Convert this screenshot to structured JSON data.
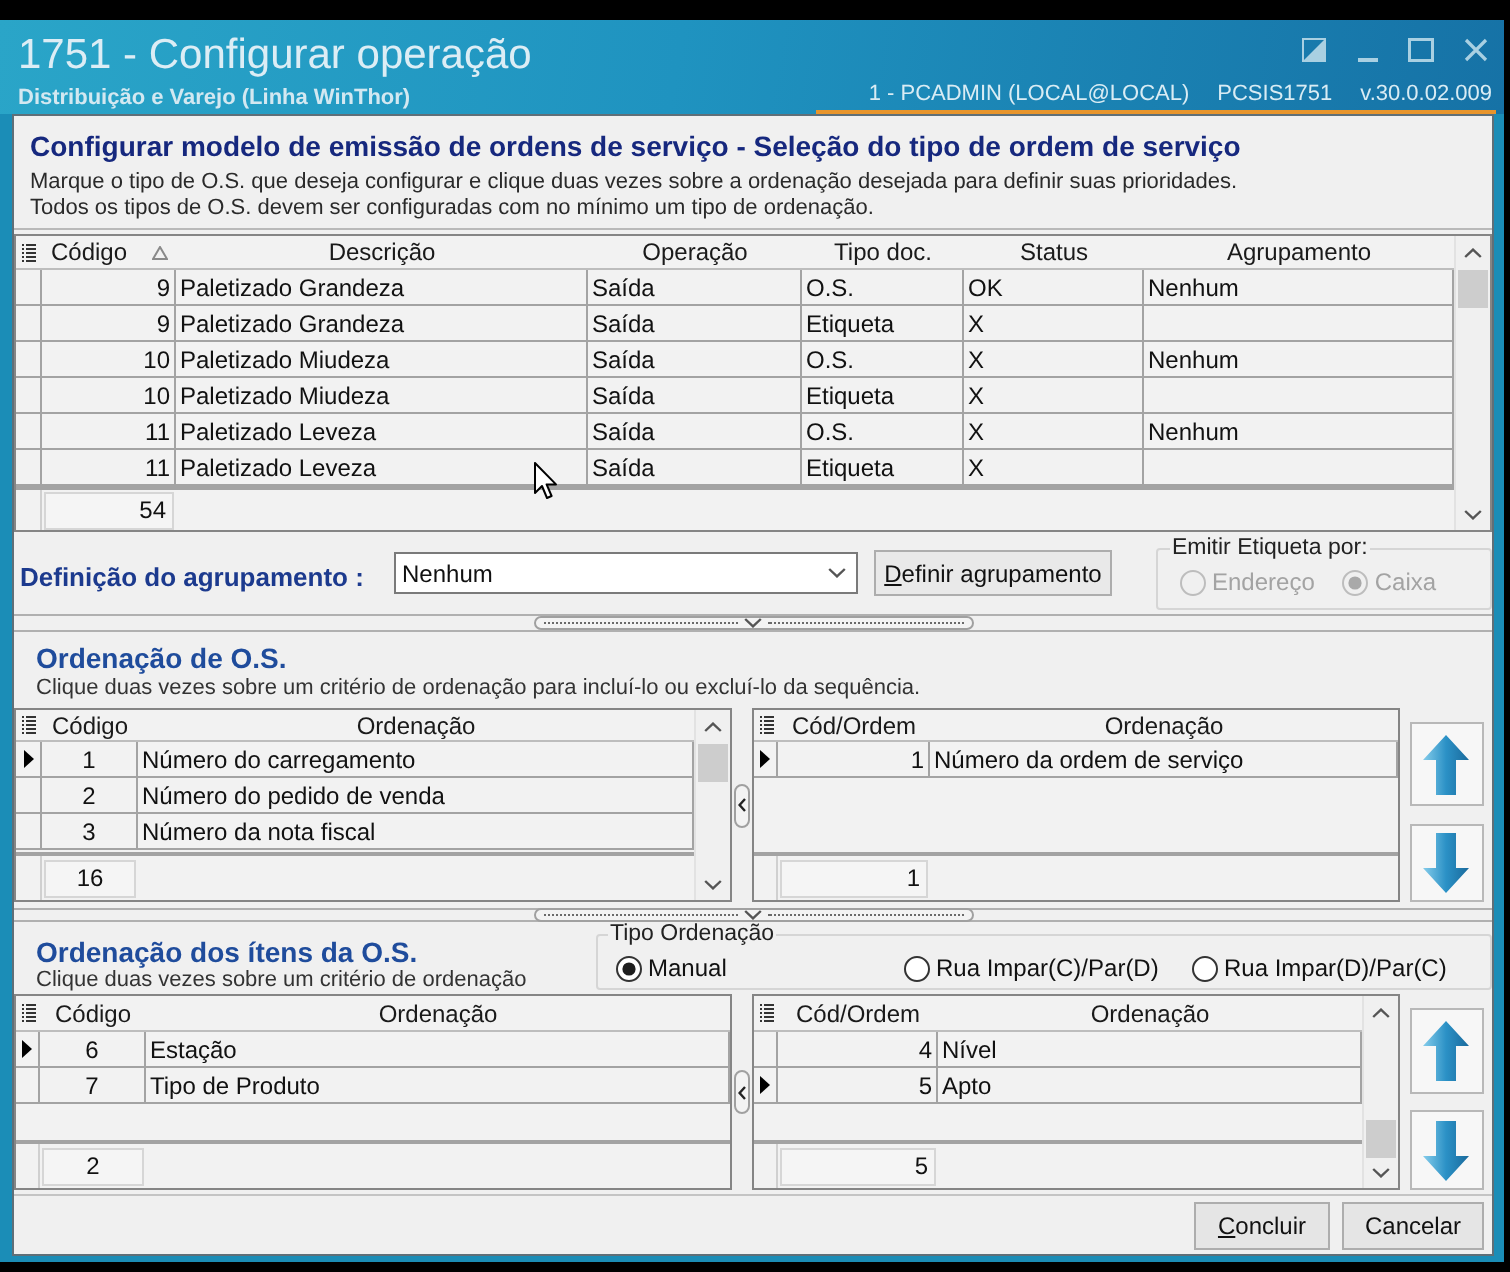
{
  "window": {
    "title": "1751 - Configurar operação",
    "subtitle": "Distribuição e Varejo (Linha WinThor)",
    "user": "1 - PCADMIN (LOCAL@LOCAL)",
    "program": "PCSIS1751",
    "version": "v.30.0.02.009"
  },
  "header": {
    "title": "Configurar modelo de emissão de ordens de serviço - Seleção do tipo de ordem de serviço",
    "lines": [
      "Marque o tipo de O.S. que deseja configurar e clique duas vezes sobre a ordenação desejada para definir suas prioridades.",
      "Todos os tipos de O.S. devem ser configuradas com no mínimo um tipo de ordenação."
    ]
  },
  "os_types_table": {
    "columns": [
      {
        "label": "Código",
        "sorted": true
      },
      {
        "label": "Descrição",
        "sorted": false
      },
      {
        "label": "Operação",
        "sorted": false
      },
      {
        "label": "Tipo doc.",
        "sorted": false
      },
      {
        "label": "Status",
        "sorted": false
      },
      {
        "label": "Agrupamento",
        "sorted": false
      }
    ],
    "rows": [
      {
        "code": "9",
        "description": "Paletizado Grandeza",
        "operation": "Saída",
        "doc_type": "O.S.",
        "status": "OK",
        "grouping": "Nenhum"
      },
      {
        "code": "9",
        "description": "Paletizado Grandeza",
        "operation": "Saída",
        "doc_type": "Etiqueta",
        "status": "X"
      },
      {
        "code": "10",
        "description": "Paletizado Miudeza",
        "operation": "Saída",
        "doc_type": "O.S.",
        "status": "X",
        "grouping": "Nenhum"
      },
      {
        "code": "10",
        "description": "Paletizado Miudeza",
        "operation": "Saída",
        "doc_type": "Etiqueta",
        "status": "X"
      },
      {
        "code": "11",
        "description": "Paletizado Leveza",
        "operation": "Saída",
        "doc_type": "O.S.",
        "status": "X",
        "grouping": "Nenhum"
      },
      {
        "code": "11",
        "description": "Paletizado Leveza",
        "operation": "Saída",
        "doc_type": "Etiqueta",
        "status": "X"
      }
    ],
    "footer": "54"
  },
  "grouping": {
    "label": "Definição do agrupamento :",
    "value": "Nenhum",
    "button": "Definir agrupamento"
  },
  "label_emission": {
    "title": "Emitir Etiqueta por:",
    "options": [
      {
        "label": "Endereço",
        "selected": false,
        "disabled": true
      },
      {
        "label": "Caixa",
        "selected": true,
        "disabled": true
      }
    ]
  },
  "os_ordering": {
    "title": "Ordenação de O.S.",
    "hint": "Clique duas vezes sobre um critério de ordenação para incluí-lo ou excluí-lo da sequência.",
    "available": {
      "columns": [
        "Código",
        "Ordenação"
      ],
      "rows": [
        {
          "code": "1",
          "name": "Número do carregamento",
          "selected": true
        },
        {
          "code": "2",
          "name": "Número do pedido de venda",
          "selected": false
        },
        {
          "code": "3",
          "name": "Número da nota fiscal",
          "selected": false
        }
      ],
      "footer": "16"
    },
    "chosen": {
      "columns": [
        "Cód/Ordem",
        "Ordenação"
      ],
      "rows": [
        {
          "code": "1",
          "name": "Número da ordem de serviço",
          "selected": true
        }
      ],
      "footer": "1"
    }
  },
  "item_ordering": {
    "title": "Ordenação dos ítens da O.S.",
    "hint": "Clique duas vezes sobre um critério de ordenação",
    "order_type": {
      "title": "Tipo Ordenação",
      "options": [
        {
          "label": "Manual",
          "selected": true
        },
        {
          "label": "Rua Impar(C)/Par(D)",
          "selected": false
        },
        {
          "label": "Rua Impar(D)/Par(C)",
          "selected": false
        }
      ]
    },
    "available": {
      "columns": [
        "Código",
        "Ordenação"
      ],
      "rows": [
        {
          "code": "6",
          "name": "Estação",
          "selected": true
        },
        {
          "code": "7",
          "name": "Tipo de Produto",
          "selected": false
        }
      ],
      "footer": "2"
    },
    "chosen": {
      "columns": [
        "Cód/Ordem",
        "Ordenação"
      ],
      "rows": [
        {
          "code": "4",
          "name": "Nível",
          "selected": false
        },
        {
          "code": "5",
          "name": "Apto",
          "selected": true
        }
      ],
      "footer": "5"
    }
  },
  "buttons": [
    "Concluir",
    "Cancelar"
  ]
}
